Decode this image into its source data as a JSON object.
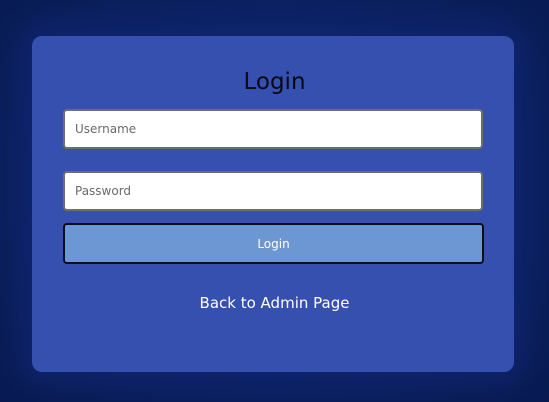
{
  "login": {
    "title": "Login",
    "username_placeholder": "Username",
    "password_placeholder": "Password",
    "submit_label": "Login",
    "back_link": "Back to Admin Page"
  },
  "colors": {
    "page_background": "#0a1f5c",
    "card_background": "#3650b0",
    "button_background": "#6d97d2"
  }
}
